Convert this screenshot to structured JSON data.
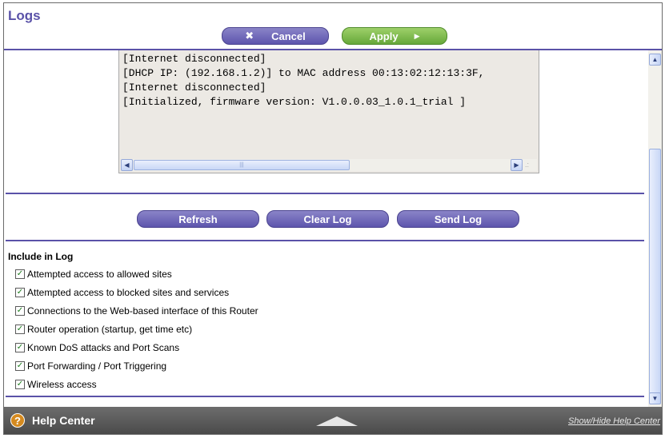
{
  "header": {
    "title": "Logs",
    "cancel_label": "Cancel",
    "apply_label": "Apply"
  },
  "log": {
    "lines": [
      "[Internet disconnected]",
      "[DHCP IP: (192.168.1.2)] to MAC address 00:13:02:12:13:3F,",
      "[Internet disconnected]",
      "[Initialized, firmware version: V1.0.0.03_1.0.1_trial ]"
    ]
  },
  "actions": {
    "refresh_label": "Refresh",
    "clear_label": "Clear Log",
    "send_label": "Send Log"
  },
  "include": {
    "title": "Include in Log",
    "options": [
      {
        "label": "Attempted access to allowed sites",
        "checked": true
      },
      {
        "label": "Attempted access to blocked sites and services",
        "checked": true
      },
      {
        "label": "Connections to the Web-based interface of this Router",
        "checked": true
      },
      {
        "label": "Router operation (startup, get time etc)",
        "checked": true
      },
      {
        "label": "Known DoS attacks and Port Scans",
        "checked": true
      },
      {
        "label": "Port Forwarding / Port Triggering",
        "checked": true
      },
      {
        "label": "Wireless access",
        "checked": true
      }
    ]
  },
  "footer": {
    "help_label": "Help Center",
    "toggle_link": "Show/Hide Help Center"
  },
  "colors": {
    "accent": "#5a52a8",
    "apply_green": "#66a83a",
    "footer_bg": "#5a5a5a"
  }
}
